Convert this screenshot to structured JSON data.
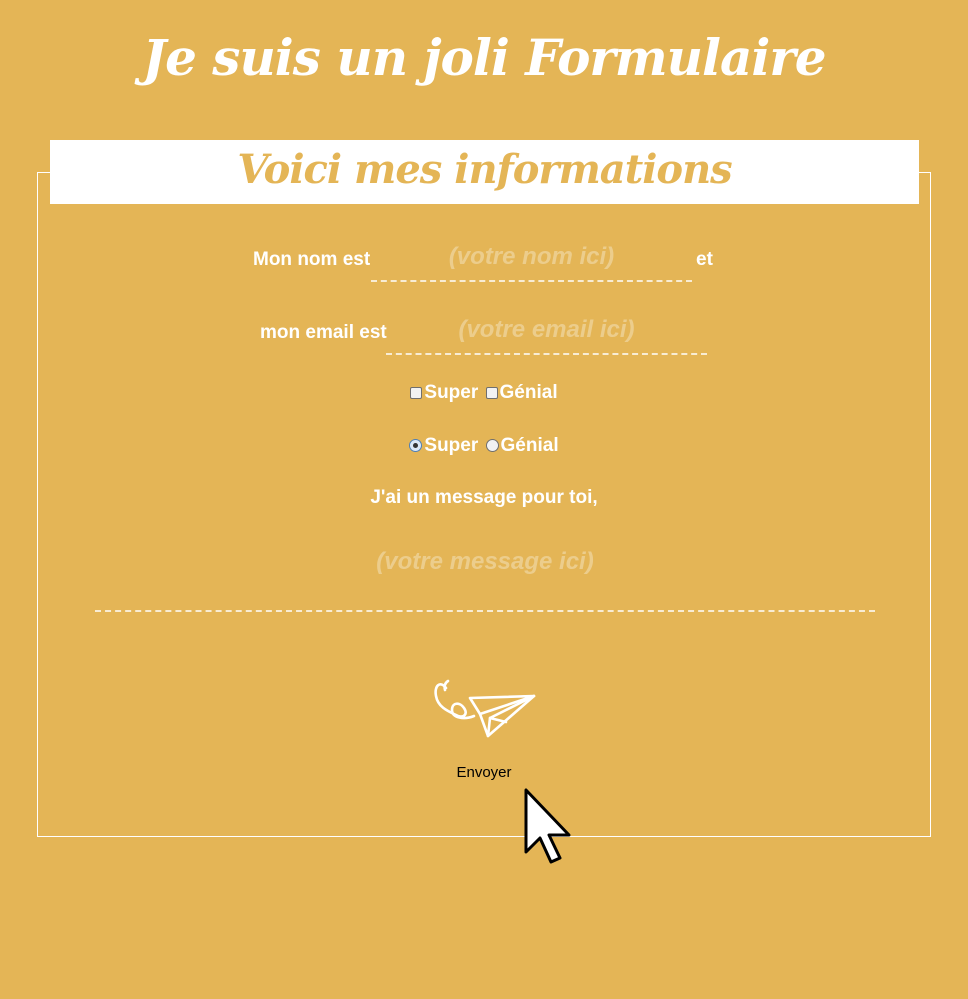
{
  "header": {
    "title": "Je suis un joli Formulaire"
  },
  "form": {
    "legend": "Voici mes informations",
    "name_label": "Mon nom est",
    "name_placeholder": "(votre nom ici)",
    "name_suffix": "et",
    "email_label": "mon email est",
    "email_placeholder": "(votre email ici)",
    "checkboxes": [
      {
        "label": "Super",
        "checked": false
      },
      {
        "label": "Génial",
        "checked": false
      }
    ],
    "radios": [
      {
        "label": "Super",
        "checked": true
      },
      {
        "label": "Génial",
        "checked": false
      }
    ],
    "message_label": "J'ai un message pour toi,",
    "message_placeholder": "(votre message ici)",
    "send_label": "Envoyer",
    "send_icon": "paper-plane-icon"
  },
  "pointer": {
    "icon": "mouse-cursor-icon"
  },
  "colors": {
    "background": "#e4b556",
    "text": "#ffffff",
    "legend_background": "#ffffff",
    "legend_text": "#e4b556",
    "button_text": "#000000"
  }
}
